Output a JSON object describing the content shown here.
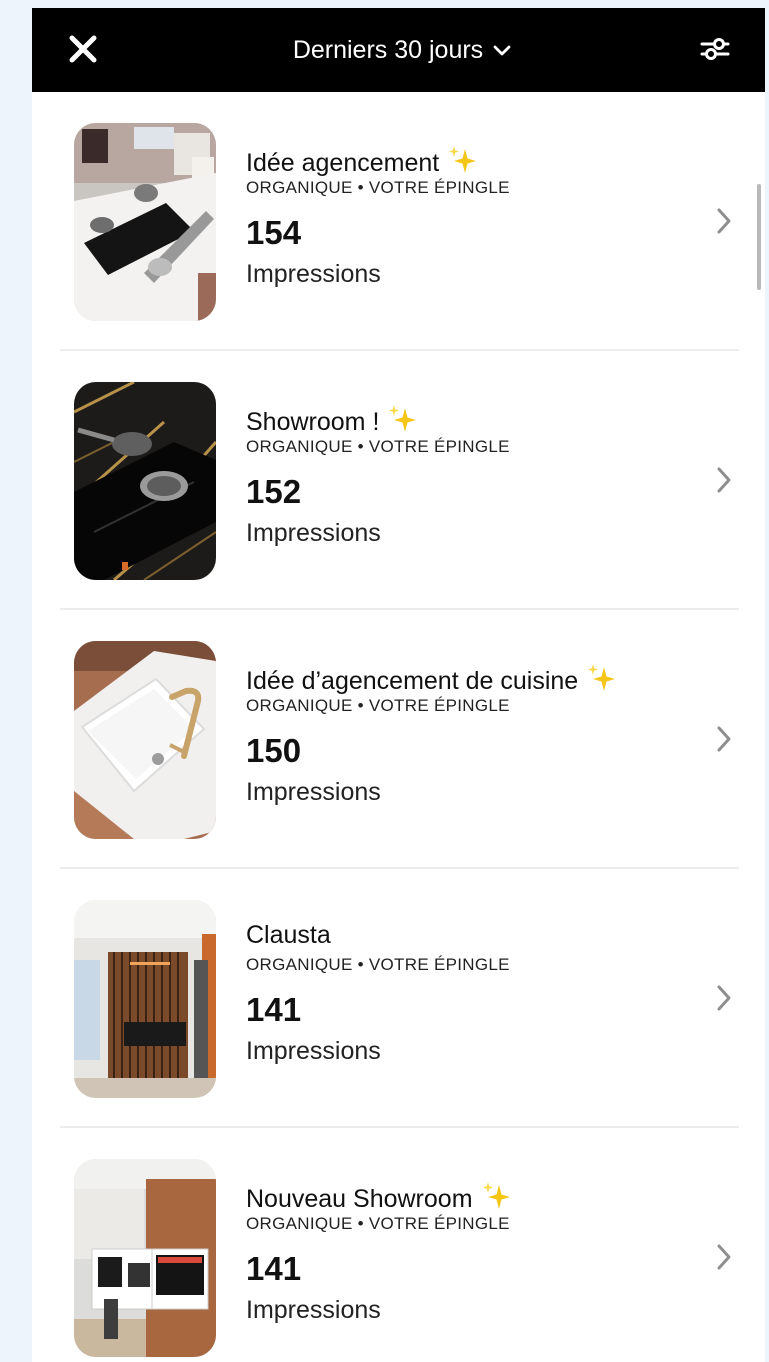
{
  "header": {
    "date_range_label": "Derniers 30 jours",
    "icons": {
      "close": "close-icon",
      "dropdown": "chevron-down-icon",
      "filter": "sliders-icon"
    }
  },
  "pins": [
    {
      "title": "Idée agencement",
      "sparkle": true,
      "meta": "ORGANIQUE • VOTRE ÉPINGLE",
      "count": "154",
      "unit": "Impressions"
    },
    {
      "title": "Showroom !",
      "sparkle": true,
      "meta": "ORGANIQUE • VOTRE ÉPINGLE",
      "count": "152",
      "unit": "Impressions"
    },
    {
      "title": "Idée d’agencement de cuisine",
      "sparkle": true,
      "meta": "ORGANIQUE • VOTRE ÉPINGLE",
      "count": "150",
      "unit": "Impressions"
    },
    {
      "title": "Clausta",
      "sparkle": false,
      "meta": "ORGANIQUE • VOTRE ÉPINGLE",
      "count": "141",
      "unit": "Impressions"
    },
    {
      "title": "Nouveau Showroom",
      "sparkle": true,
      "meta": "ORGANIQUE • VOTRE ÉPINGLE",
      "count": "141",
      "unit": "Impressions"
    }
  ],
  "colors": {
    "header_bg": "#000000",
    "divider": "#ececec",
    "chevron": "#8e8e8e",
    "sparkle": "#f5c518"
  }
}
